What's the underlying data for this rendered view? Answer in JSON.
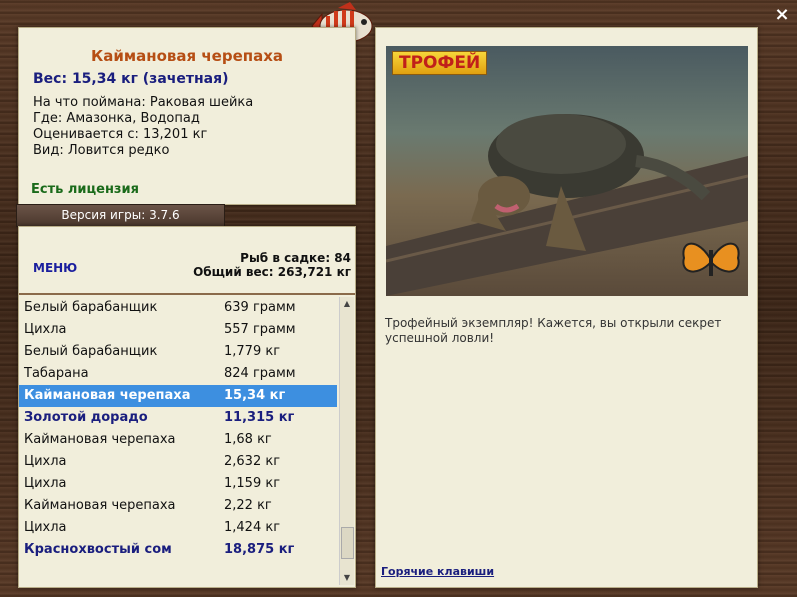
{
  "catch": {
    "title": "Каймановая черепаха",
    "weight": "Вес: 15,34 кг (зачетная)",
    "bait": "На что поймана: Раковая шейка",
    "location": "Где: Амазонка, Водопад",
    "valued": "Оценивается с: 13,201 кг",
    "species": "Вид: Ловится редко",
    "license": "Есть лицензия"
  },
  "version": "Версия игры: 3.7.6",
  "menu_label": "МЕНЮ",
  "stats": {
    "fish_count": "Рыб в садке: 84",
    "total_weight": "Общий вес: 263,721 кг"
  },
  "fish_list": [
    {
      "name": "Белый барабанщик",
      "weight": "639 грамм",
      "style": ""
    },
    {
      "name": "Цихла",
      "weight": "557 грамм",
      "style": ""
    },
    {
      "name": "Белый барабанщик",
      "weight": "1,779 кг",
      "style": ""
    },
    {
      "name": "Табарана",
      "weight": "824 грамм",
      "style": ""
    },
    {
      "name": "Каймановая черепаха",
      "weight": "15,34 кг",
      "style": "sel"
    },
    {
      "name": "Золотой дорадо",
      "weight": "11,315 кг",
      "style": "bold"
    },
    {
      "name": "Каймановая черепаха",
      "weight": "1,68 кг",
      "style": ""
    },
    {
      "name": "Цихла",
      "weight": "2,632 кг",
      "style": ""
    },
    {
      "name": "Цихла",
      "weight": "1,159 кг",
      "style": ""
    },
    {
      "name": "Каймановая черепаха",
      "weight": "2,22 кг",
      "style": ""
    },
    {
      "name": "Цихла",
      "weight": "1,424 кг",
      "style": ""
    },
    {
      "name": "Краснохвостый сом",
      "weight": "18,875 кг",
      "style": "bold"
    }
  ],
  "trophy": {
    "badge": "ТРОФЕЙ",
    "text": "Трофейный экземпляр! Кажется, вы открыли секрет успешной ловли!",
    "hotkeys": "Горячие клавиши"
  },
  "close_label": "×",
  "icons": {
    "close": "close-icon",
    "fish": "fish-icon",
    "butterfly": "butterfly-icon"
  }
}
